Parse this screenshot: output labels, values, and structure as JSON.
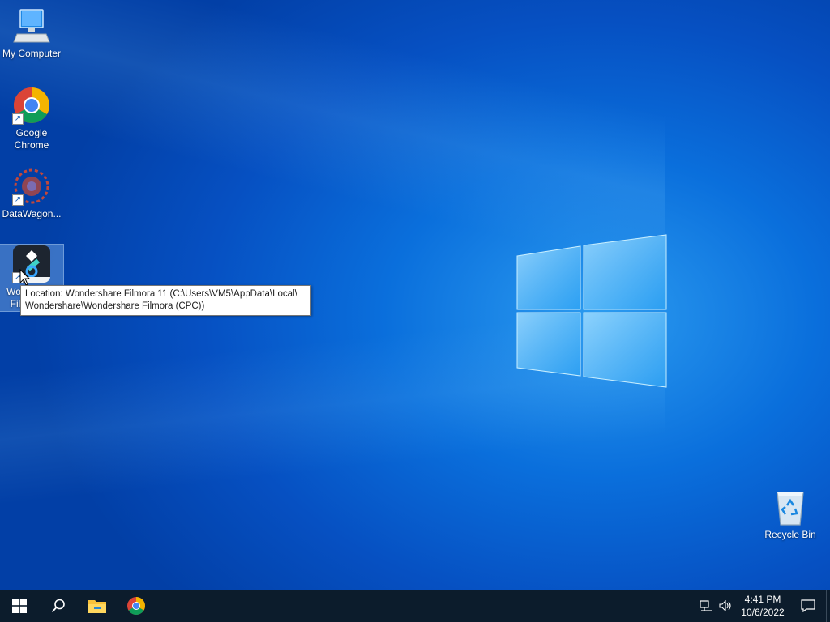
{
  "desktop": {
    "icons": [
      {
        "label": "My Computer",
        "icon": "computer-icon"
      },
      {
        "label": "Google Chrome",
        "icon": "chrome-icon"
      },
      {
        "label": "DataWagon...",
        "icon": "datawagon-icon"
      },
      {
        "label": "Wondershare Filmora 11",
        "visible_label": "Wor Fil",
        "icon": "filmora-icon",
        "selected": true
      },
      {
        "label": "Recycle Bin",
        "icon": "recycle-bin-icon"
      }
    ],
    "tooltip": {
      "line1": "Location: Wondershare Filmora 11 (C:\\Users\\VM5\\AppData\\Local\\",
      "line2": "Wondershare\\Wondershare Filmora (CPC))"
    }
  },
  "taskbar": {
    "buttons": [
      "start-icon",
      "search-icon",
      "file-explorer-icon",
      "chrome-icon"
    ],
    "tray": {
      "time": "4:41 PM",
      "date": "10/6/2022"
    }
  },
  "colors": {
    "taskbar": "#0c1c2c",
    "desktop_accent": "#0a6fdc"
  }
}
